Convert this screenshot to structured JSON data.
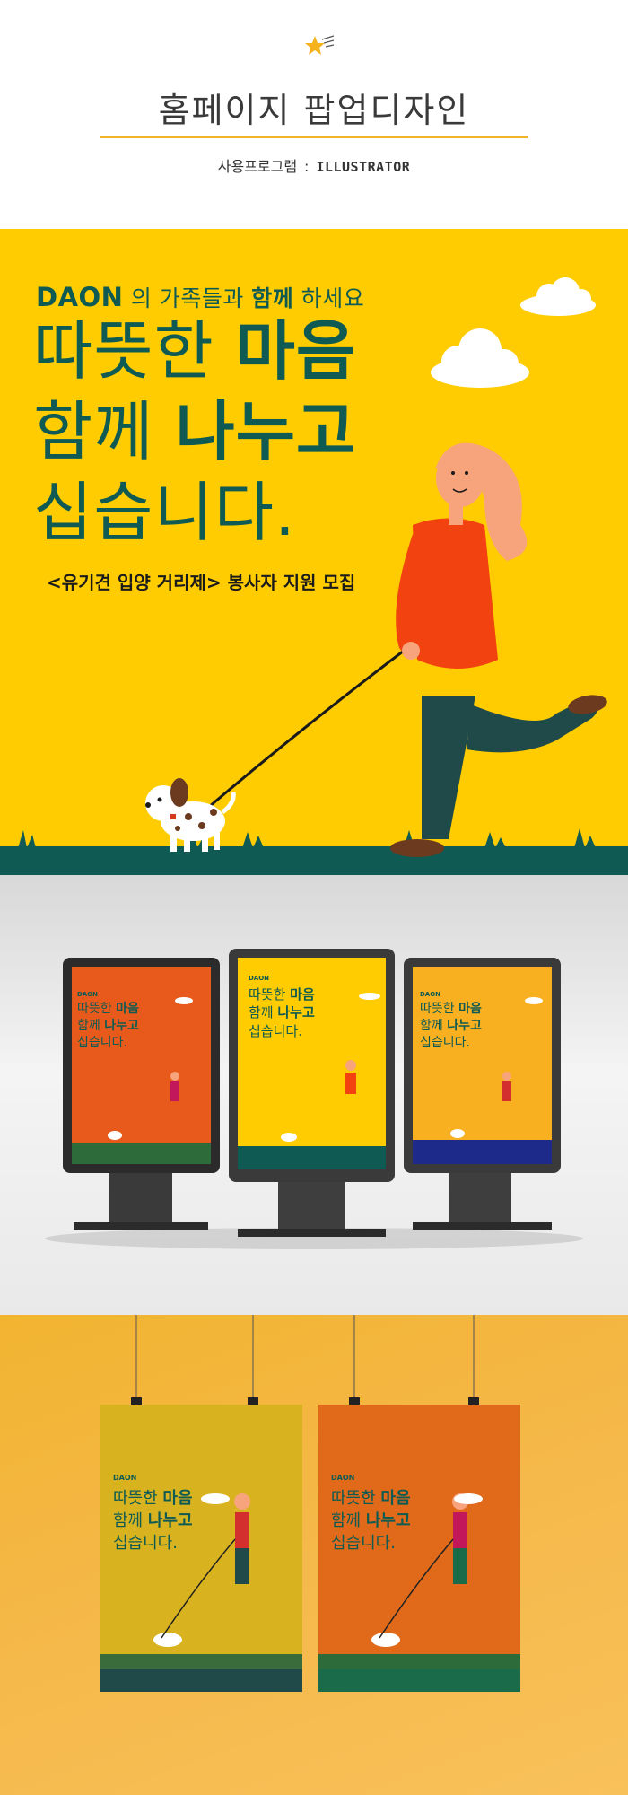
{
  "header": {
    "title": "홈페이지 팝업디자인",
    "program_label": "사용프로그램",
    "separator": ":",
    "program_value": "ILLUSTRATOR"
  },
  "banner": {
    "brand": "DAON",
    "tagline_part1": " 의 가족들과 ",
    "tagline_bold": "함께",
    "tagline_part2": " 하세요",
    "line1_normal": "따뜻한 ",
    "line1_bold": "마음",
    "line2_normal": "함께 ",
    "line2_bold": "나누고",
    "line3": "십습니다.",
    "recruit": "<유기견 입양 거리제> 봉사자 지원 모집"
  },
  "colors": {
    "banner_bg": "#fecc00",
    "text_green": "#0f5a52",
    "shirt": "#f2420f",
    "pants": "#1f4a49",
    "ground": "#0f5a52",
    "hanging_bg": "#f5b84a"
  }
}
